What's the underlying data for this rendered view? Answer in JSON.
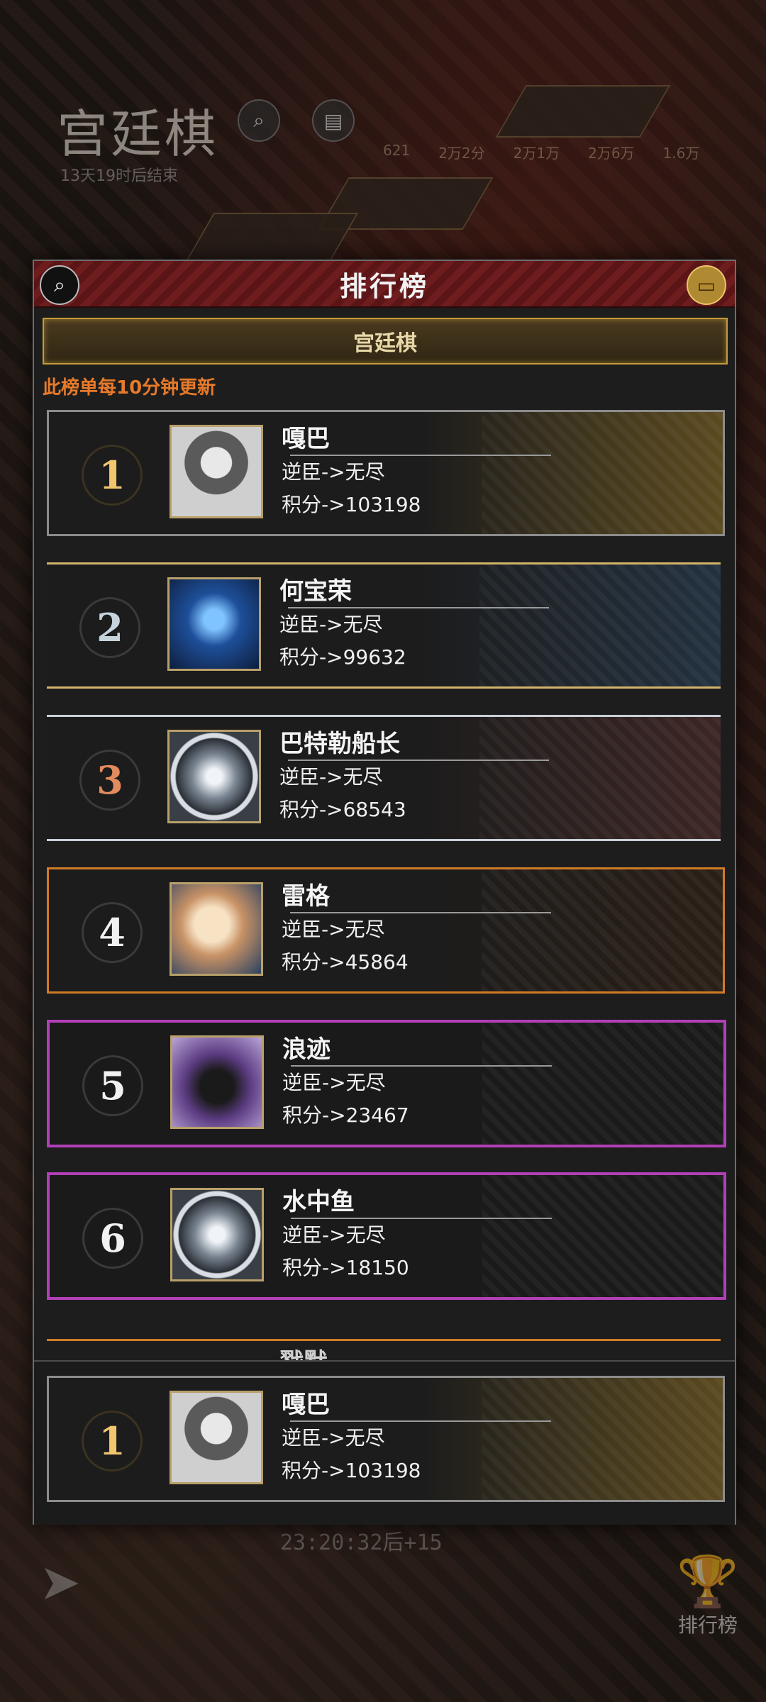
{
  "background": {
    "game_title": "宫廷棋",
    "subtitle": "13天19时后结束",
    "stats": [
      "621",
      "2万2分",
      "2万1万",
      "2万6万",
      "1.6万"
    ],
    "timer": "23:20:32后+15",
    "rank_label": "排行榜"
  },
  "modal": {
    "title": "排行榜",
    "tab": "宫廷棋",
    "notice": "此榜单每10分钟更新"
  },
  "ranking": [
    {
      "rank": "1",
      "name": "嘎巴",
      "title_line": "逆臣->无尽",
      "score_line": "积分->103198"
    },
    {
      "rank": "2",
      "name": "何宝荣",
      "title_line": "逆臣->无尽",
      "score_line": "积分->99632"
    },
    {
      "rank": "3",
      "name": "巴特勒船长",
      "title_line": "逆臣->无尽",
      "score_line": "积分->68543"
    },
    {
      "rank": "4",
      "name": "雷格",
      "title_line": "逆臣->无尽",
      "score_line": "积分->45864"
    },
    {
      "rank": "5",
      "name": "浪迹",
      "title_line": "逆臣->无尽",
      "score_line": "积分->23467"
    },
    {
      "rank": "6",
      "name": "水中鱼",
      "title_line": "逆臣->无尽",
      "score_line": "积分->18150"
    }
  ],
  "peek_name": "戮默",
  "self": {
    "rank": "1",
    "name": "嘎巴",
    "title_line": "逆臣->无尽",
    "score_line": "积分->103198"
  },
  "icons": {
    "search": "search-icon",
    "chest": "chest-icon",
    "fish": "fish-icon",
    "trophy": "trophy-icon"
  }
}
